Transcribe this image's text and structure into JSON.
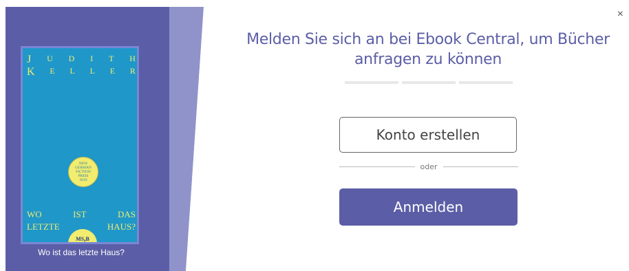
{
  "dialog": {
    "heading": "Melden Sie sich an bei Ebook Central, um Bücher anfragen zu können",
    "close_glyph": "×",
    "create_account_label": "Konto erstellen",
    "divider_text": "oder",
    "login_label": "Anmelden",
    "progress_steps": 3
  },
  "book": {
    "caption": "Wo ist das letzte Haus?",
    "cover": {
      "author_row1": [
        "J",
        "U",
        "D",
        "I",
        "T",
        "H"
      ],
      "author_row2": [
        "K",
        "E",
        "L",
        "L",
        "E",
        "R"
      ],
      "seal_lines": [
        "NEW",
        "GERMAN",
        "FICTION",
        "PREIS",
        "2018"
      ],
      "title_row1": [
        "WO",
        "IST",
        "DAS"
      ],
      "title_row2": [
        "LETZTE",
        "HAUS?"
      ],
      "publisher_mark": "MS₀B"
    }
  },
  "colors": {
    "accent": "#5b5ea6",
    "panel_bg": "#5b5ea6",
    "panel_light": "#8f93c9",
    "cover_bg": "#1f97c9",
    "cover_text": "#f2ec6f"
  }
}
